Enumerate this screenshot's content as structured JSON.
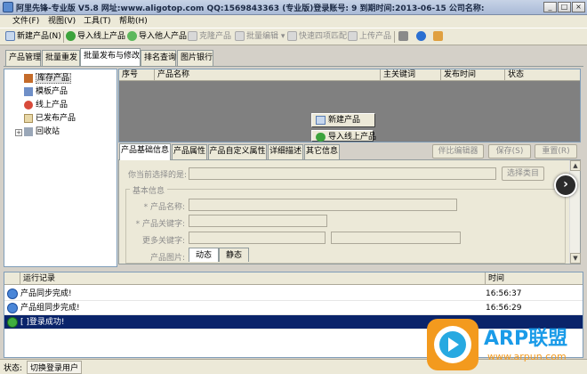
{
  "window": {
    "title": "阿里先锋-专业版 V5.8  网址:www.aligotop.com QQ:1569843363 (专业版)登录账号:                9  到期时间:2013-06-15   公司名称:",
    "minimize": "_",
    "maximize": "□",
    "close": "×"
  },
  "menu": {
    "file": "文件(F)",
    "view": "视图(V)",
    "tools": "工具(T)",
    "help": "帮助(H)"
  },
  "toolbar": {
    "new_product": "新建产品(N)",
    "import_online": "导入线上产品",
    "import_others": "导入他人产品",
    "clone_product": "克隆产品",
    "batch_edit": "批量编辑",
    "quick_match": "快速四项匹配",
    "upload_product": "上传产品"
  },
  "tabs": [
    "产品管理",
    "批量重发",
    "批量发布与修改",
    "排名查询",
    "图片银行"
  ],
  "tree": [
    "库存产品",
    "模板产品",
    "线上产品",
    "已发布产品",
    "回收站"
  ],
  "tree_expander": "+",
  "grid": {
    "columns": [
      "序号",
      "产品名称",
      "主关键词",
      "发布时间",
      "状态"
    ],
    "popup_new": "新建产品",
    "popup_import": "导入线上产品"
  },
  "detail_tabs": [
    "产品基础信息",
    "产品属性",
    "产品自定义属性",
    "详细描述",
    "其它信息"
  ],
  "detail_buttons": {
    "start_editor": "伴比编辑器",
    "save": "保存(S)",
    "reset": "重置(R)"
  },
  "form": {
    "category_label": "你当前选择的是:",
    "select_category": "选择类目",
    "group_title": "基本信息",
    "product_name": "* 产品名称:",
    "product_keyword": "* 产品关键字:",
    "more_keywords": "更多关键字:",
    "product_image": "产品图片:",
    "image_tab_dynamic": "动态",
    "image_tab_static": "静态"
  },
  "scroll": {
    "up": "▲",
    "down": "▼"
  },
  "next_button": "›",
  "log": {
    "col_record": "运行记录",
    "col_time": "时间",
    "rows": [
      {
        "msg": "产品同步完成!",
        "time": "16:56:37"
      },
      {
        "msg": "产品组同步完成!",
        "time": "16:56:29"
      },
      {
        "msg": "[              ]登录成功!",
        "time": ""
      }
    ]
  },
  "status": {
    "label": "状态:",
    "value": "切换登录用户"
  },
  "watermark": {
    "brand": "ARP联盟",
    "url": "www.arpun.com"
  },
  "colors": {
    "log_selected": "#0a246a",
    "watermark_brand": "#1a9be8",
    "watermark_orange": "#f39a1e"
  }
}
